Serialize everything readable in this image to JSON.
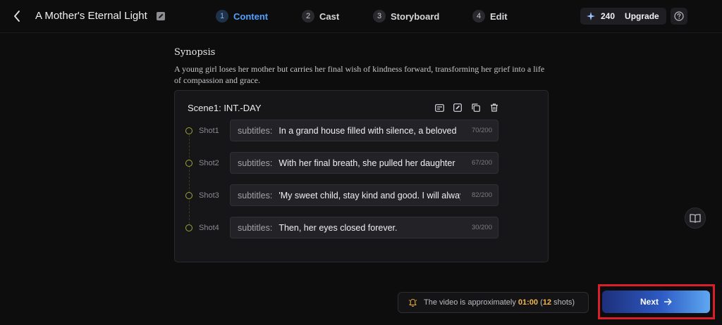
{
  "header": {
    "project_title": "A Mother's Eternal Light",
    "steps": [
      {
        "num": "1",
        "label": "Content",
        "active": true
      },
      {
        "num": "2",
        "label": "Cast",
        "active": false
      },
      {
        "num": "3",
        "label": "Storyboard",
        "active": false
      },
      {
        "num": "4",
        "label": "Edit",
        "active": false
      }
    ],
    "credits": "240",
    "upgrade_label": "Upgrade"
  },
  "synopsis": {
    "heading": "Synopsis",
    "text": "A young girl loses her mother but carries her final wish of kindness forward, transforming her grief into a life of compassion and grace."
  },
  "scene": {
    "title": "Scene1: INT.-DAY",
    "shots": [
      {
        "label": "Shot1",
        "prefix": "subtitles:",
        "text": "In a grand house filled with silence, a beloved",
        "count": "70/200"
      },
      {
        "label": "Shot2",
        "prefix": "subtitles:",
        "text": "With her final breath, she pulled her daughter",
        "count": "67/200"
      },
      {
        "label": "Shot3",
        "prefix": "subtitles:",
        "text": "'My sweet child, stay kind and good. I will always",
        "count": "82/200"
      },
      {
        "label": "Shot4",
        "prefix": "subtitles:",
        "text": "Then, her eyes closed forever.",
        "count": "30/200"
      }
    ]
  },
  "estimate": {
    "prefix": "The video is approximately ",
    "duration": "01:00",
    "open_paren": " (",
    "shots": "12",
    "suffix": " shots)"
  },
  "next_label": "Next",
  "colors": {
    "accent_blue": "#4fa3ff",
    "highlight_orange": "#f0b84a",
    "red_frame": "#d9202a"
  },
  "icons": {
    "back": "chevron-left-icon",
    "edit_title": "pencil-icon",
    "credits": "sparkle-icon",
    "help": "question-circle-icon",
    "scene_tools": [
      "image-icon",
      "edit-icon",
      "copy-icon",
      "trash-icon"
    ],
    "side": "book-icon",
    "estimate": "bell-icon",
    "next": "arrow-right-icon"
  }
}
